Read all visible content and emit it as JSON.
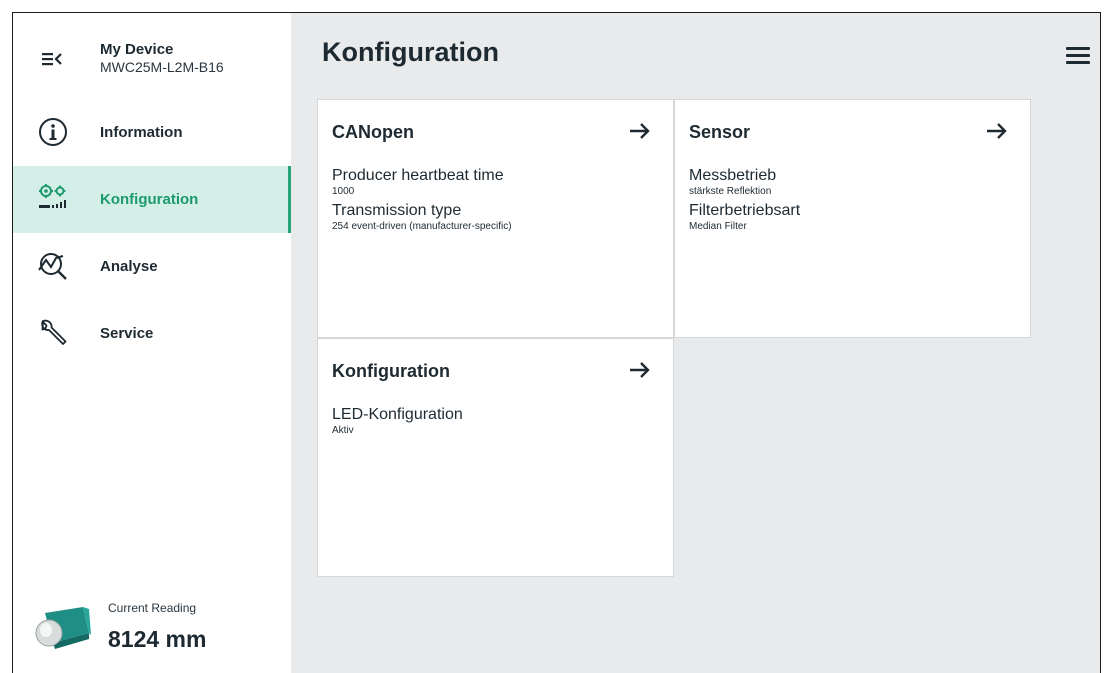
{
  "device": {
    "name": "My Device",
    "model": "MWC25M-L2M-B16"
  },
  "nav": {
    "items": [
      {
        "label": "Information",
        "icon": "info-icon"
      },
      {
        "label": "Konfiguration",
        "icon": "configuration-icon",
        "active": true
      },
      {
        "label": "Analyse",
        "icon": "analysis-icon"
      },
      {
        "label": "Service",
        "icon": "wrench-icon"
      }
    ]
  },
  "reading": {
    "label": "Current Reading",
    "value": "8124 mm"
  },
  "page": {
    "title": "Konfiguration"
  },
  "cards": [
    {
      "title": "CANopen",
      "params": [
        {
          "name": "Producer heartbeat time",
          "value": "1000"
        },
        {
          "name": "Transmission type",
          "value": "254 event-driven (manufacturer-specific)"
        }
      ]
    },
    {
      "title": "Sensor",
      "params": [
        {
          "name": "Messbetrieb",
          "value": "stärkste Reflektion"
        },
        {
          "name": "Filterbetriebsart",
          "value": "Median Filter"
        }
      ]
    },
    {
      "title": "Konfiguration",
      "params": [
        {
          "name": "LED-Konfiguration",
          "value": "Aktiv"
        }
      ]
    }
  ],
  "colors": {
    "accent": "#1c9a6c",
    "active_bg": "#d4efe8",
    "main_bg": "#e9eaeb",
    "text": "#1e2a32"
  }
}
